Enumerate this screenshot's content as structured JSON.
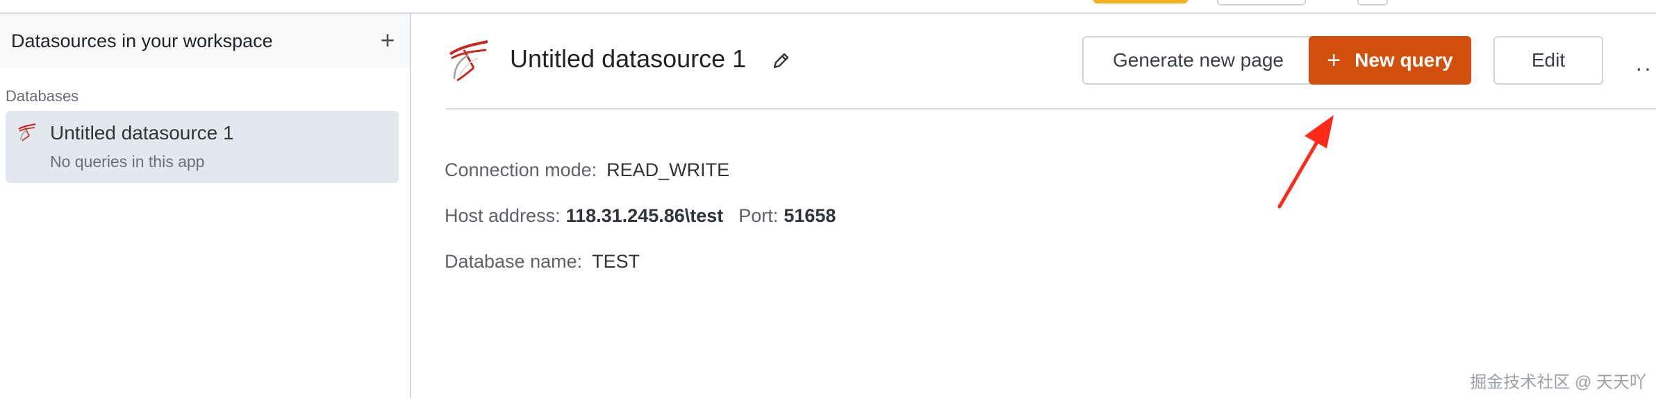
{
  "sidebar": {
    "title": "Datasources in your workspace",
    "add_icon": "plus-icon",
    "section_label": "Databases",
    "items": [
      {
        "name": "Untitled datasource 1",
        "subtitle": "No queries in this app",
        "icon": "sql-server-icon"
      }
    ]
  },
  "header": {
    "title": "Untitled datasource 1",
    "edit_icon": "pencil-icon",
    "buttons": {
      "generate": "Generate new page",
      "new_query": "New query",
      "edit": "Edit"
    },
    "more_icon": "ellipsis-icon"
  },
  "details": {
    "connection_mode_label": "Connection mode:",
    "connection_mode_value": "READ_WRITE",
    "host_label": "Host address:",
    "host_value": "118.31.245.86\\test",
    "port_label": "Port:",
    "port_value": "51658",
    "db_label": "Database name:",
    "db_value": "TEST"
  },
  "watermark": "掘金技术社区 @ 天天吖",
  "colors": {
    "primary": "#d1500d",
    "sidebar_selected": "#e3e8ee",
    "annotation_arrow": "#ff2a1a"
  }
}
